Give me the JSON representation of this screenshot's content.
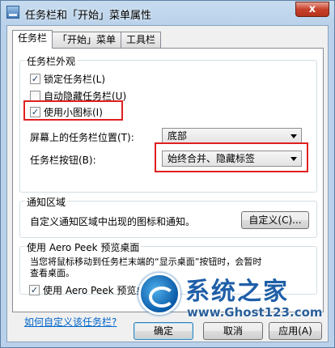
{
  "window": {
    "title": "任务栏和「开始」菜单属性",
    "close_label": "x"
  },
  "tabs": [
    {
      "label": "任务栏",
      "active": true
    },
    {
      "label": "「开始」菜单",
      "active": false
    },
    {
      "label": "工具栏",
      "active": false
    }
  ],
  "appearance": {
    "group_title": "任务栏外观",
    "lock_taskbar": {
      "label": "锁定任务栏(L)",
      "checked": true
    },
    "auto_hide": {
      "label": "自动隐藏任务栏(U)",
      "checked": false
    },
    "small_icons": {
      "label": "使用小图标(I)",
      "checked": true
    },
    "location_label": "屏幕上的任务栏位置(T):",
    "location_value": "底部",
    "buttons_label": "任务栏按钮(B):",
    "buttons_value": "始终合并、隐藏标签"
  },
  "notification": {
    "group_title": "通知区域",
    "description": "自定义通知区域中出现的图标和通知。",
    "customize_button": "自定义(C)..."
  },
  "aero_peek": {
    "group_title": "使用 Aero Peek 预览桌面",
    "description_line1": "当您将鼠标移动到任务栏末端的“显示桌面”按钮时，会暂时",
    "description_line2": "查看桌面。",
    "checkbox": {
      "label": "使用 Aero Peek 预览桌面(P)",
      "checked": true
    }
  },
  "help_link": "如何自定义该任务栏?",
  "footer": {
    "ok": "确定",
    "cancel": "取消",
    "apply": "应用(A)"
  },
  "watermark": {
    "title": "系统之家",
    "url": "www.Ghost123.com"
  },
  "colors": {
    "highlight_box": "#e02020",
    "link": "#0066cc"
  }
}
